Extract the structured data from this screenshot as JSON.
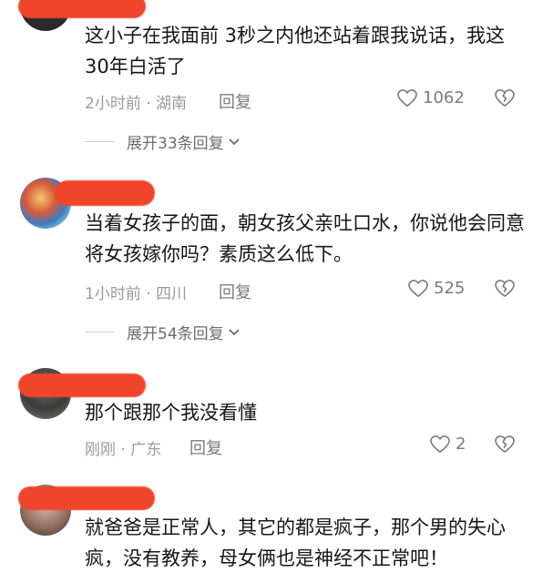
{
  "comments": [
    {
      "text": "这小子在我面前 3秒之内他还站着跟我说话，我这30年白活了",
      "meta": "2小时前 · 湖南",
      "reply_label": "回复",
      "likes": "1062",
      "expand_label": "展开33条回复"
    },
    {
      "text": "当着女孩子的面，朝女孩父亲吐口水，你说他会同意将女孩嫁你吗？素质这么低下。",
      "meta": "1小时前 · 四川",
      "reply_label": "回复",
      "likes": "525",
      "expand_label": "展开54条回复"
    },
    {
      "text": "那个跟那个我没看懂",
      "meta": "刚刚 · 广东",
      "reply_label": "回复",
      "likes": "2"
    },
    {
      "text": "就爸爸是正常人，其它的都是疯子，那个男的失心疯，没有教养，母女俩也是神经不正常吧！"
    }
  ],
  "colors": {
    "redaction": "#f0452b",
    "meta_text": "#9a9a9a",
    "action_text": "#7b7b7b"
  },
  "icons": {
    "like": "heart-outline-icon",
    "dislike": "broken-heart-icon",
    "expand": "chevron-down-icon"
  }
}
